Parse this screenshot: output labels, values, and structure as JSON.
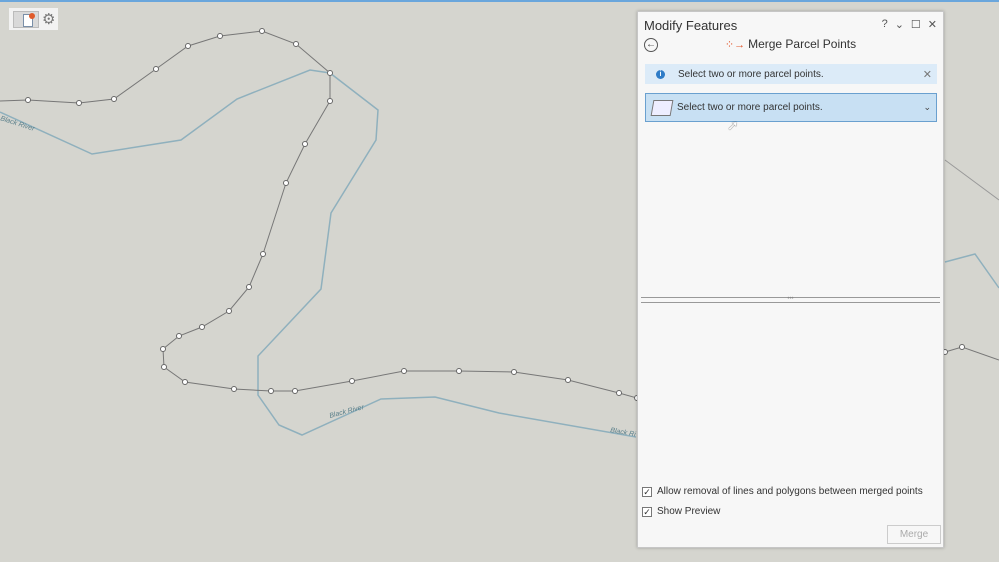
{
  "map": {
    "river_labels": [
      "Black River",
      "Black River",
      "Black Ri"
    ]
  },
  "pane": {
    "title": "Modify Features",
    "help": "?",
    "tool_title": "Merge Parcel Points",
    "info_message": "Select two or more parcel points.",
    "selection_prompt": "Select two or more parcel points.",
    "options": [
      {
        "label": "Allow removal of lines and polygons between merged points",
        "checked": true
      },
      {
        "label": "Show Preview",
        "checked": true
      }
    ],
    "merge_label": "Merge"
  }
}
